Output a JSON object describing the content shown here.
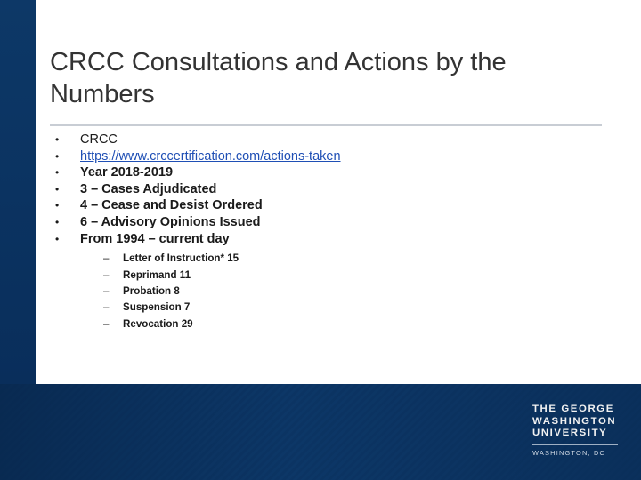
{
  "slide": {
    "title": "CRCC Consultations and Actions by the Numbers",
    "bullets": [
      {
        "text": "CRCC",
        "style": "plain"
      },
      {
        "text": "https://www.crccertification.com/actions-taken",
        "style": "link"
      },
      {
        "text": "Year 2018-2019",
        "style": "bold"
      },
      {
        "text": "3 – Cases Adjudicated",
        "style": "bold"
      },
      {
        "text": "4 – Cease and Desist Ordered",
        "style": "bold"
      },
      {
        "text": "6 – Advisory Opinions Issued",
        "style": "bold"
      },
      {
        "text": "From 1994 – current day",
        "style": "bold"
      }
    ],
    "sub_bullets": [
      "Letter of Instruction* 15",
      "Reprimand 11",
      "Probation  8",
      "Suspension  7",
      "Revocation 29"
    ],
    "bullet_glyph": "•",
    "dash_glyph": "–",
    "logo": {
      "line1": "THE GEORGE",
      "line2": "WASHINGTON",
      "line3": "UNIVERSITY",
      "line4": "WASHINGTON, DC"
    }
  }
}
